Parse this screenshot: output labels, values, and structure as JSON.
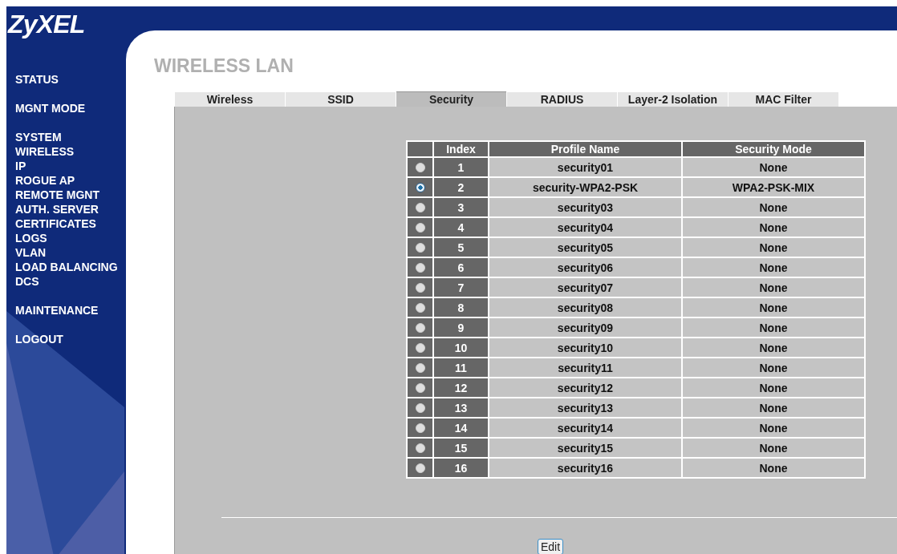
{
  "logo": "ZyXEL",
  "sidebar": {
    "groups": [
      [
        "STATUS"
      ],
      [
        "MGNT MODE"
      ],
      [
        "SYSTEM",
        "WIRELESS",
        "IP",
        "ROGUE AP",
        "REMOTE MGNT",
        "AUTH. SERVER",
        "CERTIFICATES",
        "LOGS",
        "VLAN",
        "LOAD BALANCING",
        "DCS"
      ],
      [
        "MAINTENANCE"
      ],
      [
        "LOGOUT"
      ]
    ]
  },
  "page_title": "WIRELESS LAN",
  "tabs": [
    {
      "label": "Wireless",
      "selected": false
    },
    {
      "label": "SSID",
      "selected": false
    },
    {
      "label": "Security",
      "selected": true
    },
    {
      "label": "RADIUS",
      "selected": false
    },
    {
      "label": "Layer-2 Isolation",
      "selected": false
    },
    {
      "label": "MAC Filter",
      "selected": false
    }
  ],
  "table": {
    "columns": [
      "Index",
      "Profile Name",
      "Security Mode"
    ],
    "rows": [
      {
        "index": "1",
        "profile": "security01",
        "mode": "None",
        "selected": false
      },
      {
        "index": "2",
        "profile": "security-WPA2-PSK",
        "mode": "WPA2-PSK-MIX",
        "selected": true
      },
      {
        "index": "3",
        "profile": "security03",
        "mode": "None",
        "selected": false
      },
      {
        "index": "4",
        "profile": "security04",
        "mode": "None",
        "selected": false
      },
      {
        "index": "5",
        "profile": "security05",
        "mode": "None",
        "selected": false
      },
      {
        "index": "6",
        "profile": "security06",
        "mode": "None",
        "selected": false
      },
      {
        "index": "7",
        "profile": "security07",
        "mode": "None",
        "selected": false
      },
      {
        "index": "8",
        "profile": "security08",
        "mode": "None",
        "selected": false
      },
      {
        "index": "9",
        "profile": "security09",
        "mode": "None",
        "selected": false
      },
      {
        "index": "10",
        "profile": "security10",
        "mode": "None",
        "selected": false
      },
      {
        "index": "11",
        "profile": "security11",
        "mode": "None",
        "selected": false
      },
      {
        "index": "12",
        "profile": "security12",
        "mode": "None",
        "selected": false
      },
      {
        "index": "13",
        "profile": "security13",
        "mode": "None",
        "selected": false
      },
      {
        "index": "14",
        "profile": "security14",
        "mode": "None",
        "selected": false
      },
      {
        "index": "15",
        "profile": "security15",
        "mode": "None",
        "selected": false
      },
      {
        "index": "16",
        "profile": "security16",
        "mode": "None",
        "selected": false
      }
    ]
  },
  "edit_button": "Edit"
}
